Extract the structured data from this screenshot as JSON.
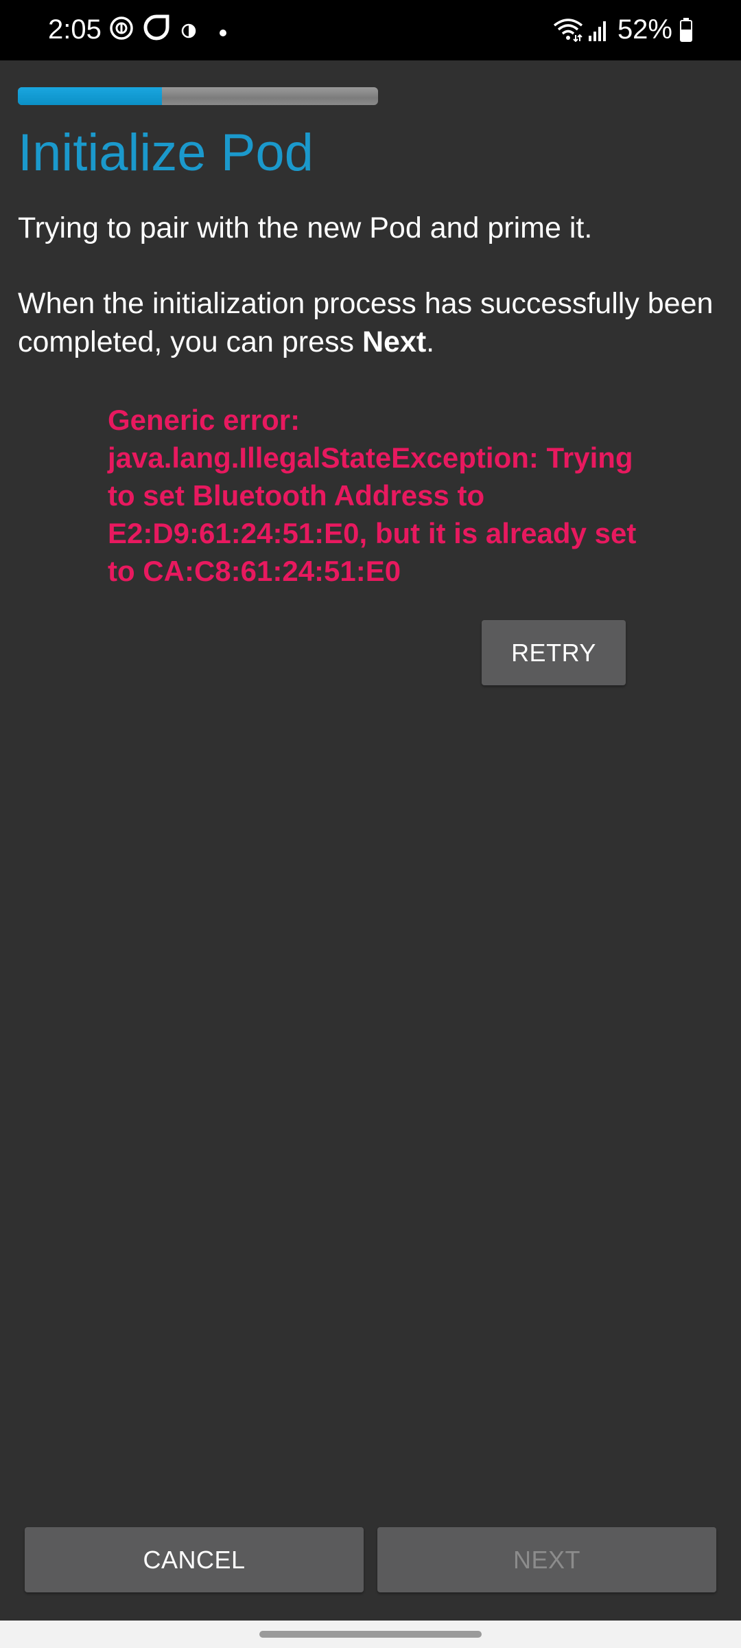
{
  "status_bar": {
    "time": "2:05",
    "battery": "52%",
    "icons": [
      "data-saver-icon",
      "ring-icon",
      "contrast-icon",
      "notification-dot-icon",
      "wifi-icon",
      "signal-icon",
      "battery-icon"
    ]
  },
  "wizard": {
    "progress_fraction": 0.4
  },
  "page": {
    "title": "Initialize Pod",
    "paragraph1": "Trying to pair with the new Pod and prime it.",
    "paragraph2_prefix": "When the initialization process has successfully been completed, you can press ",
    "paragraph2_bold": "Next",
    "paragraph2_suffix": ".",
    "error_text": "Generic error: java.lang.IllegalStateException: Trying to set Bluetooth Address to E2:D9:61:24:51:E0, but it is already set to CA:C8:61:24:51:E0"
  },
  "buttons": {
    "retry": "RETRY",
    "cancel": "CANCEL",
    "next": "NEXT"
  },
  "colors": {
    "accent": "#1b99cc",
    "error": "#e8195f",
    "background": "#303030",
    "button": "#5b5b5c"
  }
}
